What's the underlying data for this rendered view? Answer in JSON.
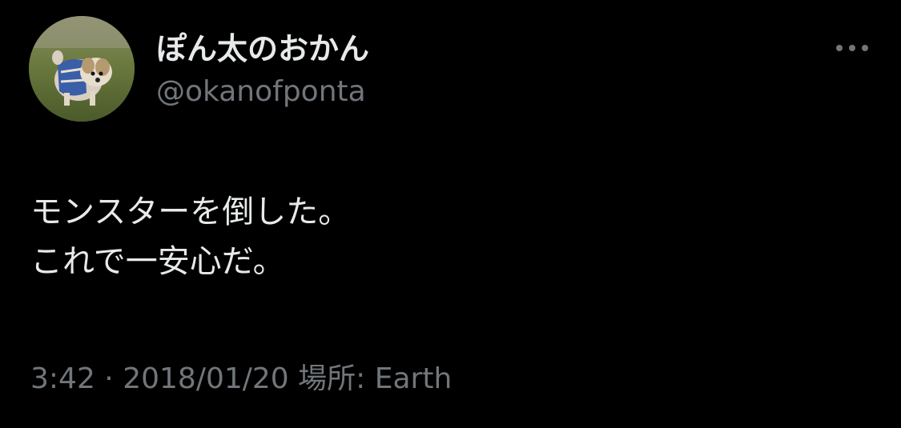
{
  "user": {
    "display_name": "ぽん太のおかん",
    "handle": "@okanofponta"
  },
  "tweet": {
    "lines": [
      "モンスターを倒した。",
      "これで一安心だ。"
    ]
  },
  "meta": {
    "time": "3:42",
    "separator": "·",
    "date": "2018/01/20",
    "location_label": "場所:",
    "location": "Earth"
  },
  "icons": {
    "more": "more-horizontal-icon",
    "avatar": "dog-photo-avatar"
  },
  "colors": {
    "background": "#000000",
    "primary_text": "#e7e9ea",
    "secondary_text": "#71767b"
  }
}
